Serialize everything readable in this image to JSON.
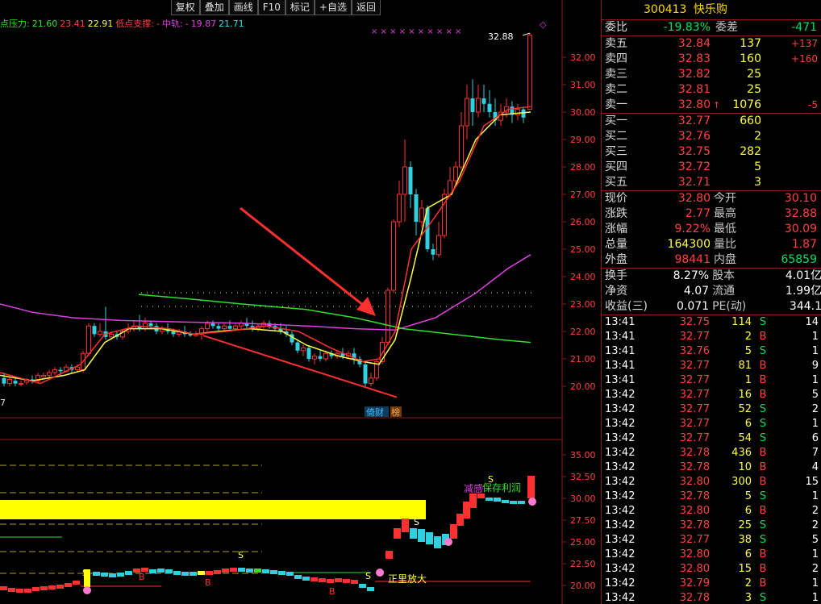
{
  "toolbar": {
    "buttons": [
      "复权",
      "叠加",
      "画线",
      "F10",
      "标记",
      "+自选",
      "返回"
    ]
  },
  "legend": {
    "prefix": "点压力:",
    "v1": "21.60",
    "v2": "23.41",
    "v3": "22.91",
    "low_label": "低点支撑:",
    "low_val": "-",
    "mid_label": "中轨:",
    "mid_val": "-",
    "v4": "19.87",
    "v5": "21.71"
  },
  "price_axis": [
    "32.00",
    "31.00",
    "30.00",
    "29.00",
    "28.00",
    "27.00",
    "26.00",
    "25.00",
    "24.00",
    "23.00",
    "22.00",
    "21.00",
    "20.00"
  ],
  "sub_axis": [
    "35.00",
    "32.50",
    "30.00",
    "27.50",
    "25.00",
    "22.50",
    "20.00"
  ],
  "annotations": {
    "high_label": "32.88",
    "left_val": "7",
    "badge1": "倚财",
    "badge2": "榜",
    "s_mark": "S",
    "b_mark": "B",
    "reduce": "减感",
    "keep": "保存利润",
    "amplify": "正里放大"
  },
  "colors": {
    "up": "#ff3030",
    "down": "#30d0e0",
    "ma_yellow": "#ffff40",
    "ma_magenta": "#e040e0",
    "ma_green": "#30e030"
  },
  "stock": {
    "code": "300413",
    "name": "快乐购"
  },
  "order_book": {
    "weibi_label": "委比",
    "weibi_val": "-19.83%",
    "weicha_label": "委差",
    "weicha_val": "-471",
    "sells": [
      {
        "label": "卖五",
        "price": "32.84",
        "vol": "137",
        "chg": "+137"
      },
      {
        "label": "卖四",
        "price": "32.83",
        "vol": "160",
        "chg": "+160"
      },
      {
        "label": "卖三",
        "price": "32.82",
        "vol": "25",
        "chg": ""
      },
      {
        "label": "卖二",
        "price": "32.81",
        "vol": "25",
        "chg": ""
      },
      {
        "label": "卖一",
        "price": "32.80",
        "vol": "1076",
        "chg": "-5",
        "arrow": "↑"
      }
    ],
    "buys": [
      {
        "label": "买一",
        "price": "32.77",
        "vol": "660"
      },
      {
        "label": "买二",
        "price": "32.76",
        "vol": "2"
      },
      {
        "label": "买三",
        "price": "32.75",
        "vol": "282"
      },
      {
        "label": "买四",
        "price": "32.72",
        "vol": "5"
      },
      {
        "label": "买五",
        "price": "32.71",
        "vol": "3"
      }
    ]
  },
  "quote": [
    {
      "l1": "现价",
      "v1": "32.80",
      "c1": "red",
      "l2": "今开",
      "v2": "30.10",
      "c2": "red"
    },
    {
      "l1": "涨跌",
      "v1": "2.77",
      "c1": "red",
      "l2": "最高",
      "v2": "32.88",
      "c2": "red"
    },
    {
      "l1": "涨幅",
      "v1": "9.22%",
      "c1": "red",
      "l2": "最低",
      "v2": "30.09",
      "c2": "red"
    },
    {
      "l1": "总量",
      "v1": "164300",
      "c1": "yel",
      "l2": "量比",
      "v2": "1.87",
      "c2": "red"
    },
    {
      "l1": "外盘",
      "v1": "98441",
      "c1": "red",
      "l2": "内盘",
      "v2": "65859",
      "c2": "green"
    }
  ],
  "fund": [
    {
      "l1": "换手",
      "v1": "8.27%",
      "l2": "股本",
      "v2": "4.01亿"
    },
    {
      "l1": "净资",
      "v1": "4.07",
      "l2": "流通",
      "v2": "1.99亿"
    },
    {
      "l1": "收益(三)",
      "v1": "0.071",
      "l2": "PE(动)",
      "v2": "344.1"
    }
  ],
  "ticks": [
    {
      "t": "13:41",
      "p": "32.75",
      "v": "114",
      "bs": "S",
      "n": "14"
    },
    {
      "t": "13:41",
      "p": "32.77",
      "v": "2",
      "bs": "B",
      "n": "1"
    },
    {
      "t": "13:41",
      "p": "32.76",
      "v": "5",
      "bs": "S",
      "n": "1"
    },
    {
      "t": "13:41",
      "p": "32.77",
      "v": "81",
      "bs": "B",
      "n": "9"
    },
    {
      "t": "13:41",
      "p": "32.77",
      "v": "1",
      "bs": "B",
      "n": "1"
    },
    {
      "t": "13:42",
      "p": "32.77",
      "v": "16",
      "bs": "B",
      "n": "5"
    },
    {
      "t": "13:42",
      "p": "32.77",
      "v": "52",
      "bs": "S",
      "n": "2"
    },
    {
      "t": "13:42",
      "p": "32.77",
      "v": "6",
      "bs": "S",
      "n": "1"
    },
    {
      "t": "13:42",
      "p": "32.77",
      "v": "54",
      "bs": "S",
      "n": "6"
    },
    {
      "t": "13:42",
      "p": "32.78",
      "v": "436",
      "bs": "B",
      "n": "7"
    },
    {
      "t": "13:42",
      "p": "32.78",
      "v": "10",
      "bs": "B",
      "n": "4"
    },
    {
      "t": "13:42",
      "p": "32.80",
      "v": "300",
      "bs": "B",
      "n": "15"
    },
    {
      "t": "13:42",
      "p": "32.78",
      "v": "5",
      "bs": "S",
      "n": "1"
    },
    {
      "t": "13:42",
      "p": "32.80",
      "v": "6",
      "bs": "B",
      "n": "2"
    },
    {
      "t": "13:42",
      "p": "32.78",
      "v": "25",
      "bs": "S",
      "n": "2"
    },
    {
      "t": "13:42",
      "p": "32.77",
      "v": "38",
      "bs": "S",
      "n": "5"
    },
    {
      "t": "13:42",
      "p": "32.80",
      "v": "6",
      "bs": "B",
      "n": "1"
    },
    {
      "t": "13:42",
      "p": "32.80",
      "v": "15",
      "bs": "B",
      "n": "2"
    },
    {
      "t": "13:42",
      "p": "32.79",
      "v": "2",
      "bs": "B",
      "n": "1"
    },
    {
      "t": "13:42",
      "p": "32.78",
      "v": "3",
      "bs": "S",
      "n": "1"
    }
  ]
}
